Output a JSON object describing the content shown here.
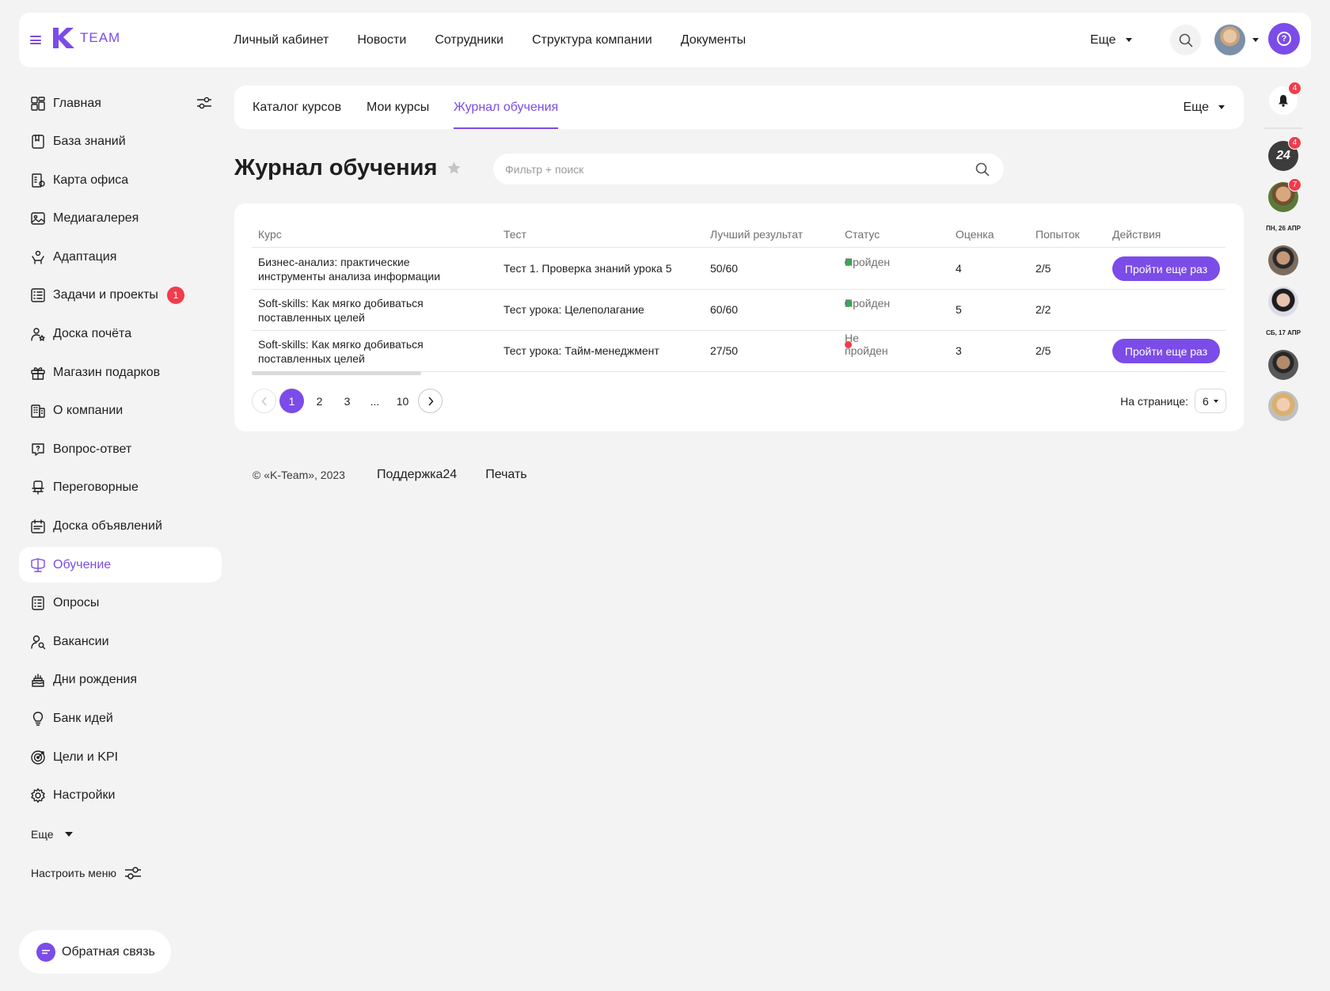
{
  "header": {
    "logo_text": "TEAM",
    "nav": [
      "Личный кабинет",
      "Новости",
      "Сотрудники",
      "Структура компании",
      "Документы"
    ],
    "more_label": "Еще"
  },
  "sidebar": {
    "items": [
      {
        "label": "Главная",
        "icon": "dashboard-icon"
      },
      {
        "label": "База знаний",
        "icon": "book-icon"
      },
      {
        "label": "Карта офиса",
        "icon": "office-map-icon"
      },
      {
        "label": "Медиагалерея",
        "icon": "image-icon"
      },
      {
        "label": "Адаптация",
        "icon": "adaptation-icon"
      },
      {
        "label": "Задачи и проекты",
        "icon": "tasks-icon",
        "badge": "1"
      },
      {
        "label": "Доска почёта",
        "icon": "honor-board-icon"
      },
      {
        "label": "Магазин подарков",
        "icon": "gift-icon"
      },
      {
        "label": "О компании",
        "icon": "building-icon"
      },
      {
        "label": "Вопрос-ответ",
        "icon": "question-icon"
      },
      {
        "label": "Переговорные",
        "icon": "meeting-room-icon"
      },
      {
        "label": "Доска объявлений",
        "icon": "announcements-icon"
      },
      {
        "label": "Обучение",
        "icon": "learning-icon",
        "active": true
      },
      {
        "label": "Опросы",
        "icon": "survey-icon"
      },
      {
        "label": "Вакансии",
        "icon": "vacancy-icon"
      },
      {
        "label": "Дни рождения",
        "icon": "cake-icon"
      },
      {
        "label": "Банк идей",
        "icon": "bulb-icon"
      },
      {
        "label": "Цели и KPI",
        "icon": "target-icon"
      },
      {
        "label": "Настройки",
        "icon": "gear-icon"
      }
    ],
    "more_label": "Еще",
    "configure_label": "Настроить меню",
    "feedback_label": "Обратная связь"
  },
  "tabs": {
    "items": [
      "Каталог курсов",
      "Мои курсы",
      "Журнал обучения"
    ],
    "active_index": 2,
    "more_label": "Еще"
  },
  "page": {
    "title": "Журнал обучения",
    "search_placeholder": "Фильтр + поиск"
  },
  "table": {
    "columns": [
      "Курс",
      "Тест",
      "Лучший результат",
      "Статус",
      "Оценка",
      "Попыток",
      "Действия"
    ],
    "rows": [
      {
        "course": "Бизнес-анализ: практические инструменты анализа информации",
        "test": "Тест 1. Проверка знаний урока 5",
        "best": "50/60",
        "status": "Пройден",
        "status_color": "#2bb24c",
        "grade": "4",
        "attempts": "2/5",
        "action": "Пройти еще раз"
      },
      {
        "course": "Soft-skills: Как мягко добиваться поставленных целей",
        "test": "Тест урока: Целеполагание",
        "best": "60/60",
        "status": "Пройден",
        "status_color": "#2bb24c",
        "grade": "5",
        "attempts": "2/2",
        "action": ""
      },
      {
        "course": "Soft-skills: Как мягко добиваться поставленных целей",
        "test": "Тест урока: Тайм-менеджмент",
        "best": "27/50",
        "status": "Не пройден",
        "status_color": "#f03c4b",
        "grade": "3",
        "attempts": "2/5",
        "action": "Пройти еще раз"
      }
    ]
  },
  "pagination": {
    "pages": [
      "1",
      "2",
      "3",
      "...",
      "10"
    ],
    "current": "1",
    "per_page_label": "На странице:",
    "per_page_value": "6"
  },
  "footer": {
    "copyright": "© «K-Team», 2023",
    "support": "Поддержка24",
    "print": "Печать"
  },
  "rail": {
    "bell_badge": "4",
    "badge_24_label": "24",
    "badge_24_count": "4",
    "avatar1_badge": "7",
    "date1": "ПН, 26 АПР",
    "date2": "СБ, 17 АПР"
  },
  "colors": {
    "accent": "#7b4ce8",
    "danger": "#f03c4b",
    "success": "#2bb24c",
    "background": "#f3f3f3"
  }
}
